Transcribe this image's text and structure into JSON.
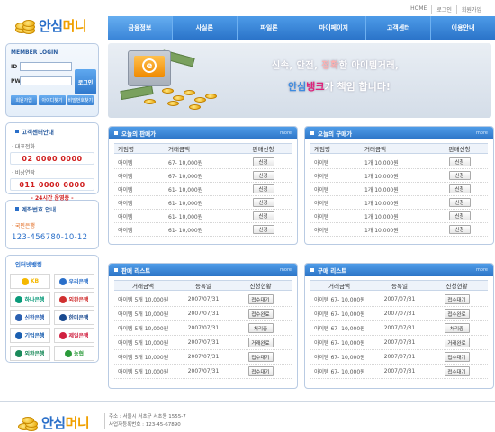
{
  "toplinks": [
    "HOME",
    "로그인",
    "회원가입"
  ],
  "logo": {
    "part1": "안심",
    "part2": "머니"
  },
  "nav": [
    "금융정보",
    "사실론",
    "파일론",
    "마이페이지",
    "고객센터",
    "이용안내"
  ],
  "login": {
    "title": "MEMBER LOGIN",
    "id_label": "ID",
    "pw_label": "PW",
    "login_button": "로그인",
    "links": [
      "회원가입",
      "아이디찾기",
      "비밀번호찾기"
    ]
  },
  "customer_center": {
    "title": "고객센터안내",
    "phone_label": "· 대표전화",
    "phone": "02  0000  0000",
    "fax_label": "· 비상연락",
    "fax": "011  0000  0000",
    "hours": "- 24시간 운영중 -"
  },
  "account": {
    "title": "계좌번호 안내",
    "bank": "· 국민은행",
    "number": "123-456780-10-12"
  },
  "banking": {
    "title": "인터넷뱅킹",
    "banks": [
      {
        "name": "KB",
        "color": "#f5b800"
      },
      {
        "name": "우리은행",
        "color": "#2a6fc9"
      },
      {
        "name": "하나은행",
        "color": "#0a9a7a"
      },
      {
        "name": "외환은행",
        "color": "#d03030"
      },
      {
        "name": "신한은행",
        "color": "#2a5fb0"
      },
      {
        "name": "한미은행",
        "color": "#1a4a90"
      },
      {
        "name": "기업은행",
        "color": "#1a5fb0"
      },
      {
        "name": "제일은행",
        "color": "#d02040"
      },
      {
        "name": "외환은행",
        "color": "#1a8a5a"
      },
      {
        "name": "농협",
        "color": "#2a9a3a"
      }
    ]
  },
  "banner": {
    "slogan_pre": "신속, 안전, ",
    "slogan_hl": "정확",
    "slogan_post": "한 아이템거래,",
    "brand1": "안심",
    "brand2": "뱅크",
    "tail": "가 책임 합니다!"
  },
  "sell_today": {
    "title": "오늘의 판매가",
    "more": "more",
    "cols": [
      "게임명",
      "거래금액",
      "판매신청"
    ],
    "rows": [
      {
        "name": "아이템",
        "rate": "67-   10,000원",
        "btn": "신청"
      },
      {
        "name": "아이템",
        "rate": "67-   10,000원",
        "btn": "신청"
      },
      {
        "name": "아이템",
        "rate": "61-   10,000원",
        "btn": "신청"
      },
      {
        "name": "아이템",
        "rate": "61-   10,000원",
        "btn": "신청"
      },
      {
        "name": "아이템",
        "rate": "61-   10,000원",
        "btn": "신청"
      },
      {
        "name": "아이템",
        "rate": "61-   10,000원",
        "btn": "신청"
      }
    ]
  },
  "buy_today": {
    "title": "오늘의 구매가",
    "more": "more",
    "cols": [
      "게임명",
      "거래금액",
      "판매신청"
    ],
    "rows": [
      {
        "name": "아이템",
        "rate": "1개   10,000원",
        "btn": "신청"
      },
      {
        "name": "아이템",
        "rate": "1개   10,000원",
        "btn": "신청"
      },
      {
        "name": "아이템",
        "rate": "1개   10,000원",
        "btn": "신청"
      },
      {
        "name": "아이템",
        "rate": "1개   10,000원",
        "btn": "신청"
      },
      {
        "name": "아이템",
        "rate": "1개   10,000원",
        "btn": "신청"
      },
      {
        "name": "아이템",
        "rate": "1개   10,000원",
        "btn": "신청"
      }
    ]
  },
  "sell_list": {
    "title": "판매 리스트",
    "more": "more",
    "cols": [
      "거래금액",
      "등록일",
      "신청현황"
    ],
    "rows": [
      {
        "rate": "아이템  5개 10,000원",
        "date": "2007/07/31",
        "status": "접수대기"
      },
      {
        "rate": "아이템  5개 10,000원",
        "date": "2007/07/31",
        "status": "접수완료"
      },
      {
        "rate": "아이템  5개 10,000원",
        "date": "2007/07/31",
        "status": "처리중"
      },
      {
        "rate": "아이템  5개 10,000원",
        "date": "2007/07/31",
        "status": "거래완료"
      },
      {
        "rate": "아이템  5개 10,000원",
        "date": "2007/07/31",
        "status": "접수대기"
      },
      {
        "rate": "아이템  5개 10,000원",
        "date": "2007/07/31",
        "status": "접수대기"
      }
    ]
  },
  "buy_list": {
    "title": "구매 리스트",
    "more": "more",
    "cols": [
      "거래금액",
      "등록일",
      "신청현황"
    ],
    "rows": [
      {
        "rate": "아이템 67-  10,000원",
        "date": "2007/07/31",
        "status": "접수대기"
      },
      {
        "rate": "아이템 67-  10,000원",
        "date": "2007/07/31",
        "status": "접수완료"
      },
      {
        "rate": "아이템 67-  10,000원",
        "date": "2007/07/31",
        "status": "처리중"
      },
      {
        "rate": "아이템 67-  10,000원",
        "date": "2007/07/31",
        "status": "거래완료"
      },
      {
        "rate": "아이템 67-  10,000원",
        "date": "2007/07/31",
        "status": "접수대기"
      },
      {
        "rate": "아이템 67-  10,000원",
        "date": "2007/07/31",
        "status": "접수대기"
      }
    ]
  },
  "footer": {
    "logo1": "안심",
    "logo2": "머니",
    "line1": "주소 : 서울시 서초구 서초동 1555-7",
    "line2": "사업자등록번호 : 123-45-67890"
  }
}
